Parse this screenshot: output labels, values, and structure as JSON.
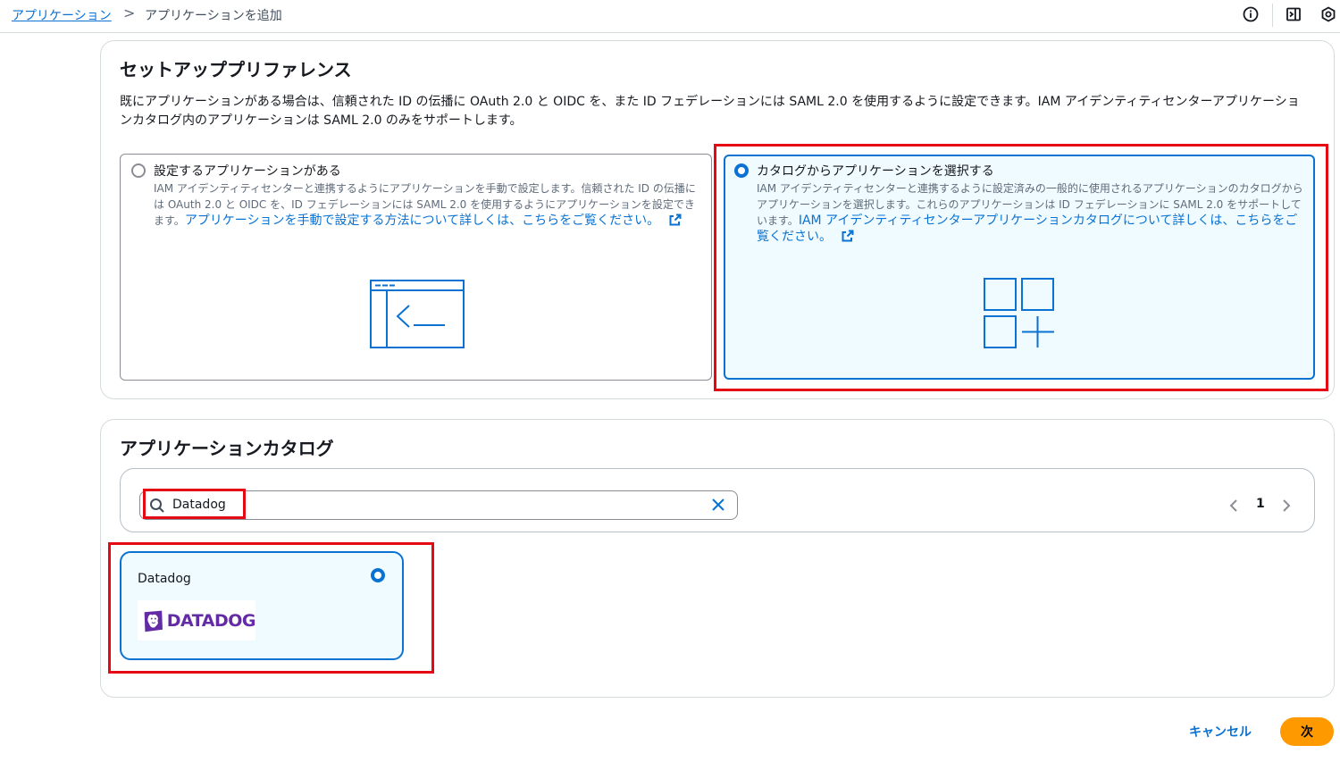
{
  "breadcrumb": {
    "parent": "アプリケーション",
    "separator": ">",
    "current": "アプリケーションを追加"
  },
  "top_icons": [
    "info-icon",
    "panel-icon",
    "settings-icon"
  ],
  "setup": {
    "title": "セットアッププリファレンス",
    "description": "既にアプリケーションがある場合は、信頼された ID の伝播に OAuth 2.0 と OIDC を、また ID フェデレーションには SAML 2.0 を使用するように設定できます。IAM アイデンティティセンターアプリケーションカタログ内のアプリケーションは SAML 2.0 のみをサポートします。",
    "options": [
      {
        "title": "設定するアプリケーションがある",
        "description": "IAM アイデンティティセンターと連携するようにアプリケーションを手動で設定します。信頼された ID の伝播には OAuth 2.0 と OIDC を、ID フェデレーションには SAML 2.0 を使用するようにアプリケーションを設定できます。",
        "link": "アプリケーションを手動で設定する方法について詳しくは、こちらをご覧ください。",
        "selected": false
      },
      {
        "title": "カタログからアプリケーションを選択する",
        "description": "IAM アイデンティティセンターと連携するように設定済みの一般的に使用されるアプリケーションのカタログからアプリケーションを選択します。これらのアプリケーションは ID フェデレーションに SAML 2.0 をサポートしています。",
        "link": "IAM アイデンティティセンターアプリケーションカタログについて詳しくは、こちらをご覧ください。",
        "selected": true
      }
    ]
  },
  "catalog": {
    "title": "アプリケーションカタログ",
    "search_value": "Datadog",
    "page": "1",
    "apps": [
      {
        "name": "Datadog",
        "logo_text": "DATADOG",
        "selected": true
      }
    ]
  },
  "colors": {
    "accent": "#0972d3",
    "primary_button": "#ff9900",
    "highlight": "#e50914",
    "datadog_purple": "#632ca6"
  },
  "footer": {
    "cancel_label": "キャンセル",
    "next_label": "次"
  }
}
